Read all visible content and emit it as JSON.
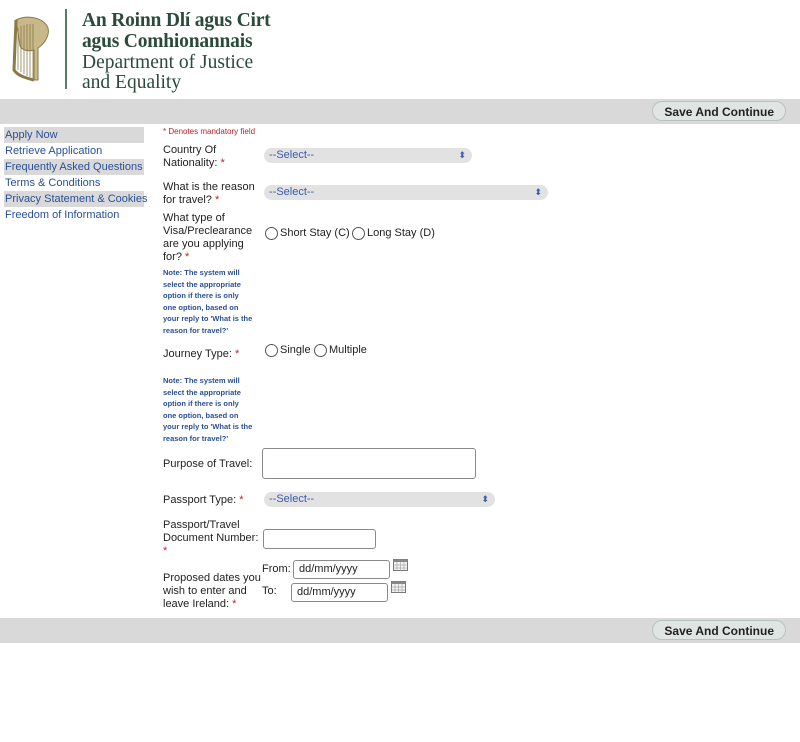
{
  "header": {
    "org_lines": [
      "An Roinn Dlí agus Cirt",
      "agus Comhionannais",
      "Department of Justice",
      "and Equality"
    ]
  },
  "toolbar": {
    "save_label": "Save And Continue"
  },
  "nav": {
    "items": [
      {
        "label": "Apply Now"
      },
      {
        "label": "Retrieve Application"
      },
      {
        "label": "Frequently Asked Questions"
      },
      {
        "label": "Terms & Conditions"
      },
      {
        "label": "Privacy Statement & Cookies"
      },
      {
        "label": "Freedom of Information"
      }
    ]
  },
  "form": {
    "mandatory_note": "* Denotes mandatory field",
    "required_mark": "*",
    "nationality": {
      "label_l1": "Country Of",
      "label_l2": "Nationality:",
      "value": "--Select--"
    },
    "reason": {
      "label_l1": "What is the reason",
      "label_l2": "for travel?",
      "value": "--Select--"
    },
    "visa_type": {
      "label_l1": "What type of",
      "label_l2": "Visa/Preclearance",
      "label_l3": "are you applying",
      "label_l4": "for?",
      "option1": "Short Stay (C)",
      "option2": "Long Stay (D)"
    },
    "note_lines": [
      "Note: The system will",
      "select the appropriate",
      "option if there is only",
      "one option, based on",
      "your reply to 'What is the",
      "reason for travel?'"
    ],
    "journey": {
      "label": "Journey Type:",
      "option1": "Single",
      "option2": "Multiple"
    },
    "purpose": {
      "label": "Purpose of Travel:"
    },
    "passport_type": {
      "label": "Passport Type:",
      "value": "--Select--"
    },
    "passport_number": {
      "label_l1": "Passport/Travel",
      "label_l2": "Document Number:"
    },
    "dates": {
      "label_l1": "Proposed dates you",
      "label_l2": "wish to enter and",
      "label_l3": "leave Ireland:",
      "from_label": "From:",
      "to_label": "To:",
      "from_placeholder": "dd/mm/yyyy",
      "to_placeholder": "dd/mm/yyyy"
    }
  }
}
